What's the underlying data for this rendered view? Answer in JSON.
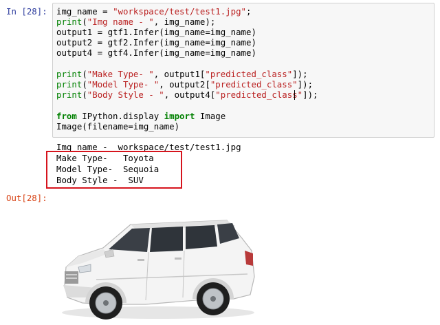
{
  "cell": {
    "in_prompt": "In [28]:",
    "out_prompt": "Out[28]:"
  },
  "code": {
    "line1_a": "img_name = ",
    "line1_str": "\"workspace/test/test1.jpg\"",
    "line1_c": ";",
    "line2_fn": "print",
    "line2_a": "(",
    "line2_str": "\"Img name - \"",
    "line2_c": ", img_name);",
    "line3": "output1 = gtf1.Infer(img_name=img_name)",
    "line4": "output2 = gtf2.Infer(img_name=img_name)",
    "line5": "output4 = gtf4.Infer(img_name=img_name)",
    "line7_fn": "print",
    "line7_a": "(",
    "line7_str": "\"Make Type- \"",
    "line7_b": ", output1[",
    "line7_str2": "\"predicted_class\"",
    "line7_c": "]);",
    "line8_fn": "print",
    "line8_a": "(",
    "line8_str": "\"Model Type- \"",
    "line8_b": ", output2[",
    "line8_str2": "\"predicted_class\"",
    "line8_c": "]);",
    "line9_fn": "print",
    "line9_a": "(",
    "line9_str": "\"Body Style - \"",
    "line9_b": ", output4[",
    "line9_str2": "\"predicted_class\"",
    "line9_c": "]);",
    "line11_kw1": "from",
    "line11_mod": " IPython.display ",
    "line11_kw2": "import",
    "line11_rest": " Image",
    "line12": "Image(filename=img_name)"
  },
  "output": {
    "line1": "Img name -  workspace/test/test1.jpg",
    "line2": "Make Type-   Toyota",
    "line3": "Model Type-  Sequoia",
    "line4": "Body Style -  SUV"
  },
  "colors": {
    "in_prompt": "#303f9f",
    "out_prompt": "#d84315",
    "string": "#ba2121",
    "keyword": "#008000",
    "highlight_box": "#d6141d"
  }
}
